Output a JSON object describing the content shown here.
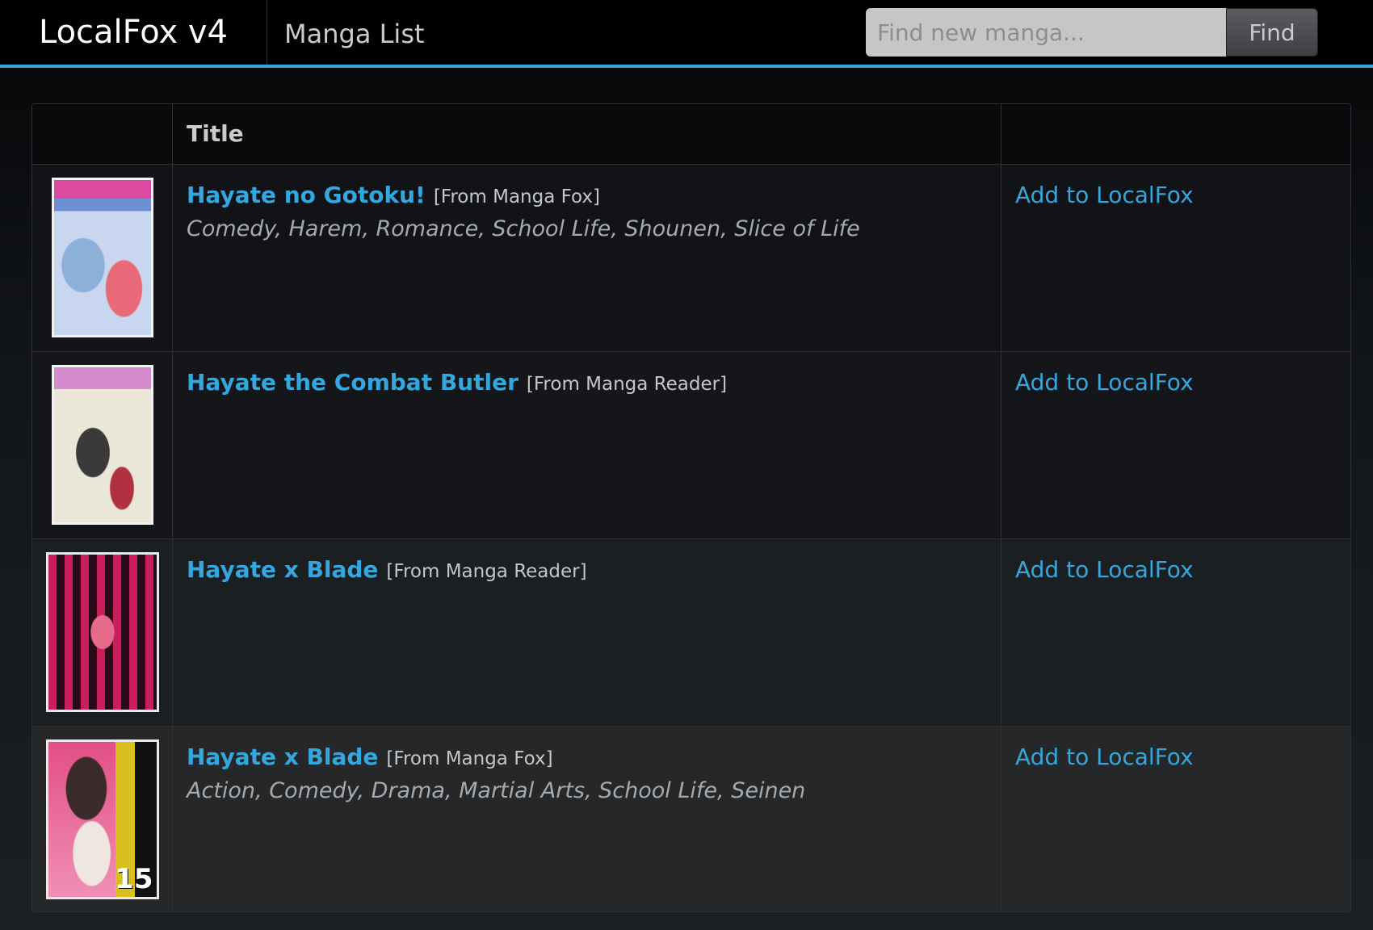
{
  "app": {
    "brand": "LocalFox v4",
    "nav_link": "Manga List"
  },
  "search": {
    "placeholder": "Find new manga...",
    "button_label": "Find"
  },
  "table": {
    "columns": [
      "",
      "Title",
      ""
    ],
    "rows": [
      {
        "title": "Hayate no Gotoku!",
        "source": "[From Manga Fox]",
        "genres": "Comedy, Harem, Romance, School Life, Shounen, Slice of Life",
        "action": "Add to LocalFox"
      },
      {
        "title": "Hayate the Combat Butler",
        "source": "[From Manga Reader]",
        "genres": "",
        "action": "Add to LocalFox"
      },
      {
        "title": "Hayate x Blade",
        "source": "[From Manga Reader]",
        "genres": "",
        "action": "Add to LocalFox"
      },
      {
        "title": "Hayate x Blade",
        "source": "[From Manga Fox]",
        "genres": "Action, Comedy, Drama, Martial Arts, School Life, Seinen",
        "action": "Add to LocalFox",
        "cover_text": "15"
      }
    ]
  },
  "colors": {
    "accent": "#35a7dd",
    "topbar": "#000000"
  }
}
